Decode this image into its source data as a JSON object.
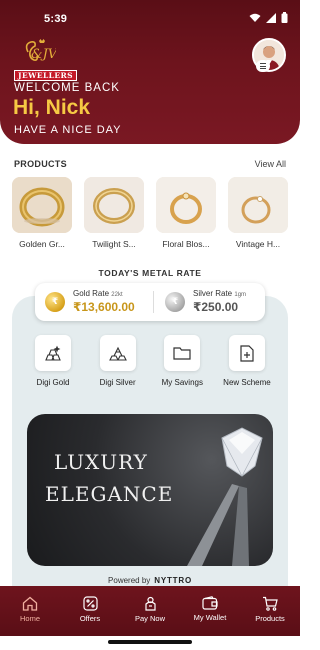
{
  "status_bar": {
    "time": "5:39"
  },
  "header": {
    "logo_text": "JEWELLERS",
    "welcome": "WELCOME BACK",
    "greeting": "Hi, Nick",
    "subtitle": "HAVE A NICE DAY"
  },
  "products": {
    "title": "PRODUCTS",
    "view_all": "View All",
    "items": [
      {
        "name": "Golden Gr..."
      },
      {
        "name": "Twilight S..."
      },
      {
        "name": "Floral Blos..."
      },
      {
        "name": "Vintage H..."
      }
    ]
  },
  "metal_rate": {
    "title": "TODAY'S METAL RATE",
    "gold": {
      "label": "Gold Rate",
      "purity": "22kt",
      "value": "₹13,600.00",
      "coin_symbol": "₹"
    },
    "silver": {
      "label": "Silver Rate",
      "purity": "1gm",
      "value": "₹250.00",
      "coin_symbol": "₹"
    }
  },
  "actions": [
    {
      "label": "Digi Gold",
      "icon": "gold-bars-icon"
    },
    {
      "label": "Digi Silver",
      "icon": "silver-bars-icon"
    },
    {
      "label": "My Savings",
      "icon": "folder-icon"
    },
    {
      "label": "New Scheme",
      "icon": "new-document-icon"
    }
  ],
  "banner": {
    "line1": "LUXURY",
    "line2": "ELEGANCE"
  },
  "footer": {
    "powered_by": "Powered by",
    "brand": "NYTTRO"
  },
  "bottom_nav": [
    {
      "label": "Home",
      "icon": "home-icon",
      "active": true
    },
    {
      "label": "Offers",
      "icon": "offers-icon",
      "active": false
    },
    {
      "label": "Pay Now",
      "icon": "pay-now-icon",
      "active": false
    },
    {
      "label": "My Wallet",
      "icon": "wallet-icon",
      "active": false
    },
    {
      "label": "Products",
      "icon": "cart-icon",
      "active": false
    }
  ],
  "colors": {
    "primary": "#6e141d",
    "accent_gold": "#f6c944",
    "rate_gold": "#c8961a"
  }
}
